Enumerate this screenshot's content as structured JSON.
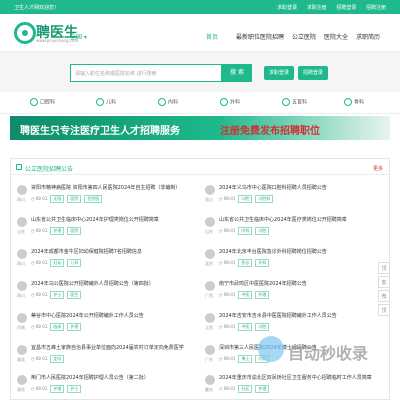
{
  "topbar": {
    "welcome": "卫生人才网欢迎您！",
    "links": [
      "求职登录",
      "求职注册",
      "招聘登录",
      "招聘注册"
    ]
  },
  "header": {
    "logo_text": "聘医生",
    "logo_sub": "www.pinyisheng.com",
    "city": "全国"
  },
  "nav": {
    "items": [
      "首页",
      "最新职位",
      "医院招聘",
      "公立医院",
      "医院大全",
      "求职简历"
    ],
    "active": "首页"
  },
  "search": {
    "placeholder": "请输入职位名称或医院名称 进行搜索",
    "button": "搜 索",
    "login": "求职登录",
    "recruit": "招聘登录"
  },
  "categories": [
    "口腔科",
    "儿科",
    "内科",
    "外科",
    "五官科",
    "骨科"
  ],
  "banner": {
    "left": "聘医生只专注医疗卫生人才招聘服务",
    "right": "注册免费发布招聘职位"
  },
  "section": {
    "title": "公立医院招聘公告",
    "more": "更多"
  },
  "jobs": [
    {
      "title": "资阳市精神病医院 资阳市第四人民医院2024年自主招聘（非编制）",
      "loc": "四川",
      "date": "08-01",
      "tags": [
        "无限",
        "医院",
        "住院医"
      ]
    },
    {
      "title": "2024年义乌市中心医院口腔科招聘人员招聘公告",
      "loc": "浙江",
      "date": "08-01",
      "tags": [
        "口腔",
        "口腔科"
      ]
    },
    {
      "title": "山东省公共卫生临床中心2024年护理类岗位公开招聘简章",
      "loc": "山东",
      "date": "08-01",
      "tags": [
        "护理",
        "医院"
      ]
    },
    {
      "title": "山东省公共卫生临床中心2024年医疗类岗位公开招聘简章",
      "loc": "山东",
      "date": "08-01",
      "tags": [
        "内科",
        "口腔"
      ]
    },
    {
      "title": "2024年成都市金牛区妇幼保健院招聘7名招聘信息",
      "loc": "四川",
      "date": "08-01",
      "tags": [
        "妇幼",
        "儿科"
      ]
    },
    {
      "title": "2024年北京丰台医院急诊外科招聘岗位招聘公告",
      "loc": "北京",
      "date": "08-01",
      "tags": [
        "急诊",
        "外科"
      ]
    },
    {
      "title": "2024年乌公医院公开招聘编外人员招聘公告（第四批）",
      "loc": "四川",
      "date": "08-01",
      "tags": [
        "护士",
        "医生"
      ]
    },
    {
      "title": "南宁市武鸣区中医医院2024年招聘公告",
      "loc": "广西",
      "date": "08-01",
      "tags": [
        "中医",
        "护理"
      ]
    },
    {
      "title": "蒂谷市中心医院2024年公开招聘编外工作人员公告",
      "loc": "河南",
      "date": "08-01",
      "tags": [
        "临床",
        "护理"
      ]
    },
    {
      "title": "2024年吉安市吉水县中医医院招聘编外工作人员公告",
      "loc": "江西",
      "date": "08-01",
      "tags": [
        "中医",
        "口腔"
      ]
    },
    {
      "title": "宜昌市五峰土家族自治县事业单位面向2024届农村订单定向免费医学",
      "loc": "湖北",
      "date": "08-01",
      "tags": [
        "定向"
      ]
    },
    {
      "title": "深圳市第三人民医院2024年博士后招聘公告",
      "loc": "广东",
      "date": "08-01",
      "tags": [
        "博士",
        "内科"
      ]
    },
    {
      "title": "荆门市人民医院2024年招聘护理人员公告（第二批）",
      "loc": "湖北",
      "date": "08-01",
      "tags": [
        "护理",
        "护士"
      ]
    },
    {
      "title": "2024年重庆市渝北区双凤桥社区卫生服务中心招聘临时工作人员简章",
      "loc": "重庆",
      "date": "08-01",
      "tags": [
        "社区",
        "护理"
      ]
    }
  ],
  "side": [
    "顶",
    "客",
    "微",
    "顶"
  ],
  "watermark": "自动秒收录",
  "colors": {
    "accent": "#1fb98d",
    "red": "#d32f2f"
  }
}
